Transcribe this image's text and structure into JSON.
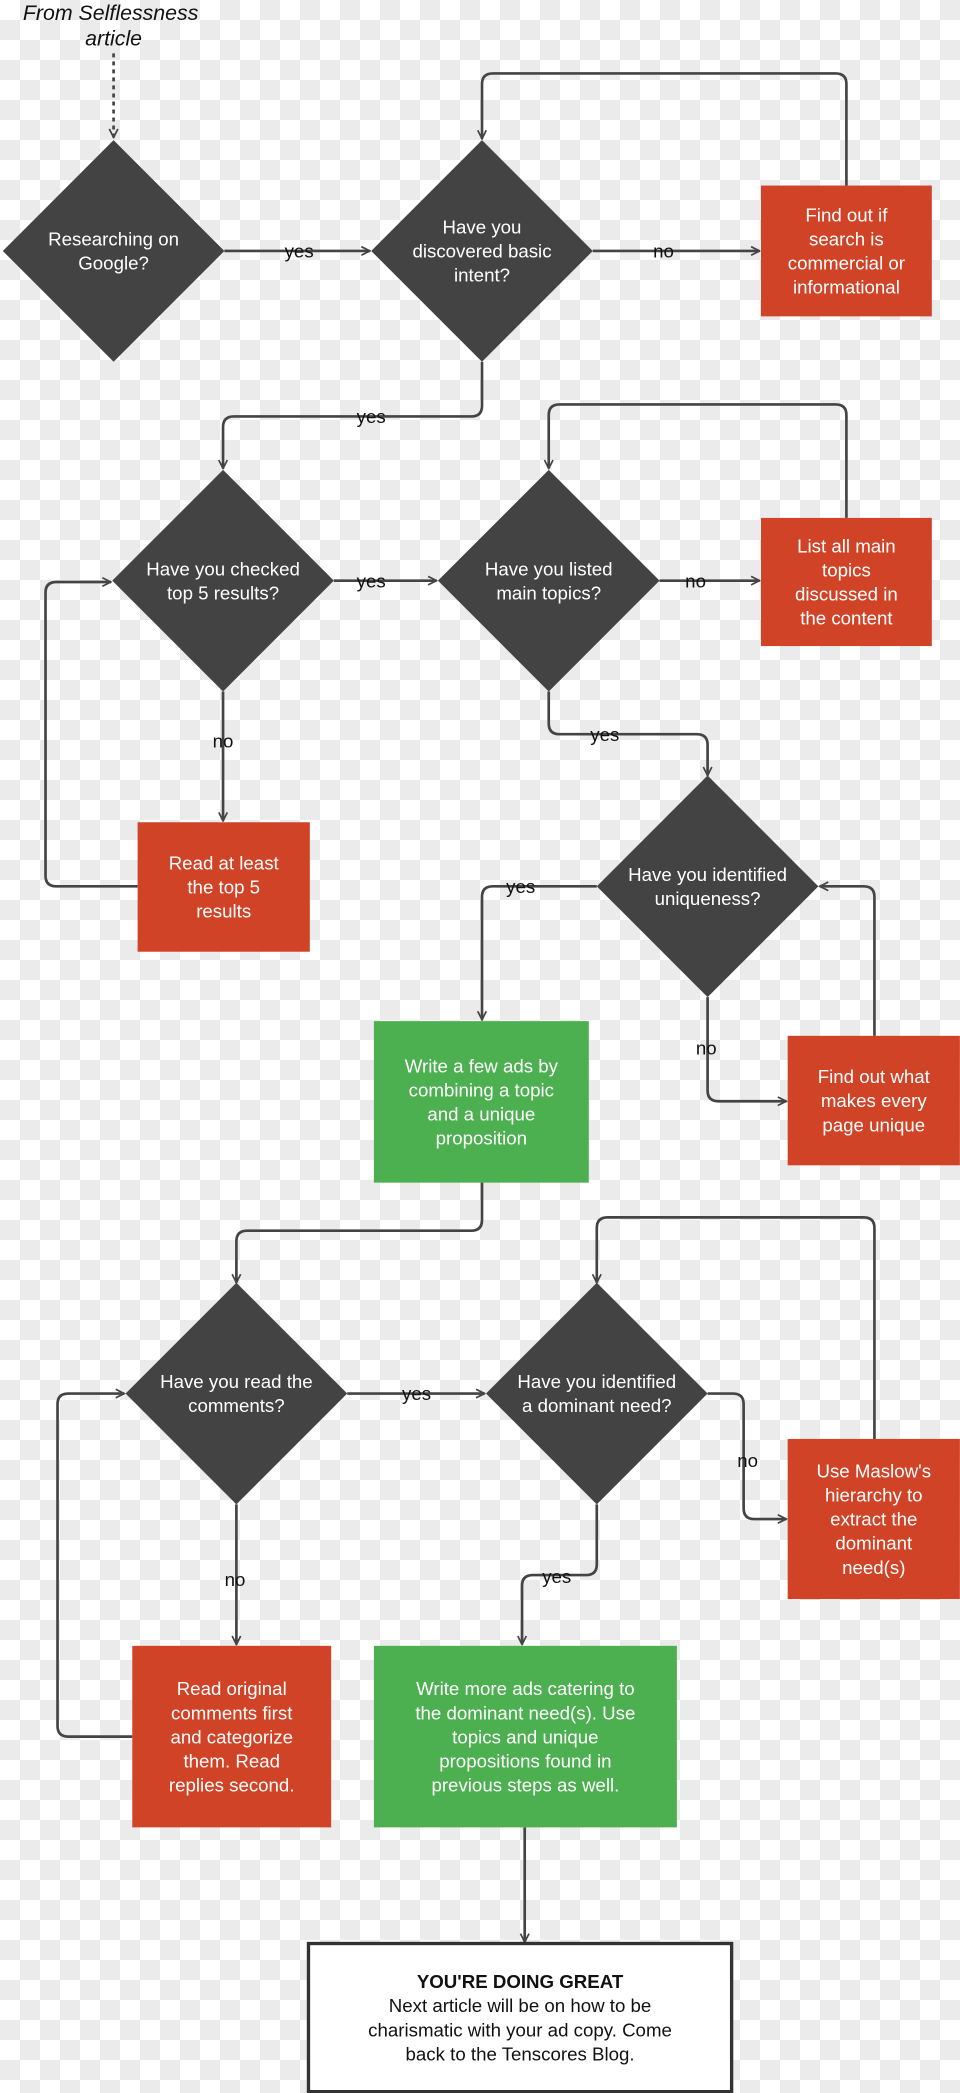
{
  "source_note": [
    "From Selflessness",
    "article"
  ],
  "colors": {
    "decision": "#434343",
    "action_red": "#d04327",
    "action_green": "#4caf50",
    "edge": "#444444"
  },
  "nodes": {
    "d1": {
      "type": "decision",
      "lines": [
        "Researching on",
        "Google?"
      ]
    },
    "d2": {
      "type": "decision",
      "lines": [
        "Have you",
        "discovered basic",
        "intent?"
      ]
    },
    "r1": {
      "type": "action",
      "lines": [
        "Find out if",
        "search is",
        "commercial or",
        "informational"
      ]
    },
    "d3": {
      "type": "decision",
      "lines": [
        "Have you checked",
        "top 5 results?"
      ]
    },
    "d4": {
      "type": "decision",
      "lines": [
        "Have you listed",
        "main topics?"
      ]
    },
    "r2": {
      "type": "action",
      "lines": [
        "List all main",
        "topics",
        "discussed in",
        "the content"
      ]
    },
    "r3": {
      "type": "action",
      "lines": [
        "Read at least",
        "the top 5",
        "results"
      ]
    },
    "d5": {
      "type": "decision",
      "lines": [
        "Have you identified",
        "uniqueness?"
      ]
    },
    "g1": {
      "type": "output",
      "lines": [
        "Write a few ads by",
        "combining a topic",
        "and a unique",
        "proposition"
      ]
    },
    "r4": {
      "type": "action",
      "lines": [
        "Find out what",
        "makes every",
        "page unique"
      ]
    },
    "d6": {
      "type": "decision",
      "lines": [
        "Have you read the",
        "comments?"
      ]
    },
    "d7": {
      "type": "decision",
      "lines": [
        "Have you identified",
        "a dominant need?"
      ]
    },
    "r5": {
      "type": "action",
      "lines": [
        "Use Maslow's",
        "hierarchy to",
        "extract the",
        "dominant",
        "need(s)"
      ]
    },
    "r6": {
      "type": "action",
      "lines": [
        "Read original",
        "comments first",
        "and categorize",
        "them. Read",
        "replies second."
      ]
    },
    "g2": {
      "type": "output",
      "lines": [
        "Write more ads catering to",
        "the dominant need(s). Use",
        "topics and unique",
        "propositions found in",
        "previous steps as well."
      ]
    },
    "end": {
      "type": "terminal",
      "title": "YOU'RE DOING GREAT",
      "lines": [
        "Next article will be on how to be",
        "charismatic with your ad copy. Come",
        "back to the Tenscores Blog."
      ]
    }
  },
  "edge_labels": {
    "d1_d2": "yes",
    "d2_r1": "no",
    "d2_d3": "yes",
    "d3_d4": "yes",
    "d4_r2": "no",
    "d3_r3": "no",
    "d4_d5": "yes",
    "d5_g1": "yes",
    "d5_r4": "no",
    "d6_d7": "yes",
    "d7_r5": "no",
    "d6_r6": "no",
    "d7_g2": "yes"
  }
}
